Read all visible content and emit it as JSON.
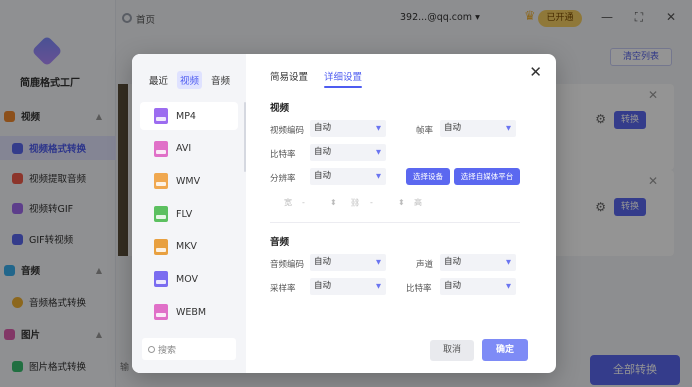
{
  "app": {
    "logo_text": "简鹿格式工厂",
    "home_tab": "首页",
    "account": "392...@qq.com",
    "vip_label": "已开通",
    "clear_list": "清空列表",
    "row_convert": "转换",
    "convert_all": "全部转换",
    "output_hint": "输"
  },
  "sidebar": {
    "items": [
      {
        "label": "视频",
        "type": "category",
        "color": "#f28a30"
      },
      {
        "label": "视频格式转换",
        "type": "item",
        "active": true,
        "color": "#5b68f0"
      },
      {
        "label": "视频提取音频",
        "type": "item",
        "color": "#f25c4a"
      },
      {
        "label": "视频转GIF",
        "type": "item",
        "color": "#a06cf0"
      },
      {
        "label": "GIF转视频",
        "type": "item",
        "color": "#5b68f0"
      },
      {
        "label": "音频",
        "type": "category",
        "color": "#3ab0f0"
      },
      {
        "label": "音频格式转换",
        "type": "item",
        "color": "#f2b233"
      },
      {
        "label": "图片",
        "type": "category",
        "color": "#e060b0"
      },
      {
        "label": "图片格式转换",
        "type": "item",
        "color": "#3ac070"
      }
    ]
  },
  "modal": {
    "left_tabs": [
      "最近",
      "视频",
      "音频"
    ],
    "formats": [
      {
        "name": "MP4",
        "color": "#9c6cf0"
      },
      {
        "name": "AVI",
        "color": "#e070c8"
      },
      {
        "name": "WMV",
        "color": "#f0a850"
      },
      {
        "name": "FLV",
        "color": "#5cc060"
      },
      {
        "name": "MKV",
        "color": "#e8a040"
      },
      {
        "name": "MOV",
        "color": "#7a6cf0"
      },
      {
        "name": "WEBM",
        "color": "#e070c8"
      }
    ],
    "search_placeholder": "搜索",
    "right_tabs": [
      "简易设置",
      "详细设置"
    ],
    "video": {
      "title": "视频",
      "codec_label": "视频编码",
      "codec_value": "自动",
      "framerate_label": "帧率",
      "framerate_value": "自动",
      "bitrate_label": "比特率",
      "bitrate_value": "自动",
      "resolution_label": "分辨率",
      "resolution_value": "自动",
      "select_device": "选择设备",
      "select_platform": "选择自媒体平台",
      "width_label": "宽",
      "height_label": "高",
      "width_value": "-",
      "height_value": "-"
    },
    "audio": {
      "title": "音频",
      "codec_label": "音频编码",
      "codec_value": "自动",
      "channel_label": "声道",
      "channel_value": "自动",
      "samplerate_label": "采样率",
      "samplerate_value": "自动",
      "bitrate_label": "比特率",
      "bitrate_value": "自动"
    },
    "cancel": "取消",
    "confirm": "确定"
  }
}
